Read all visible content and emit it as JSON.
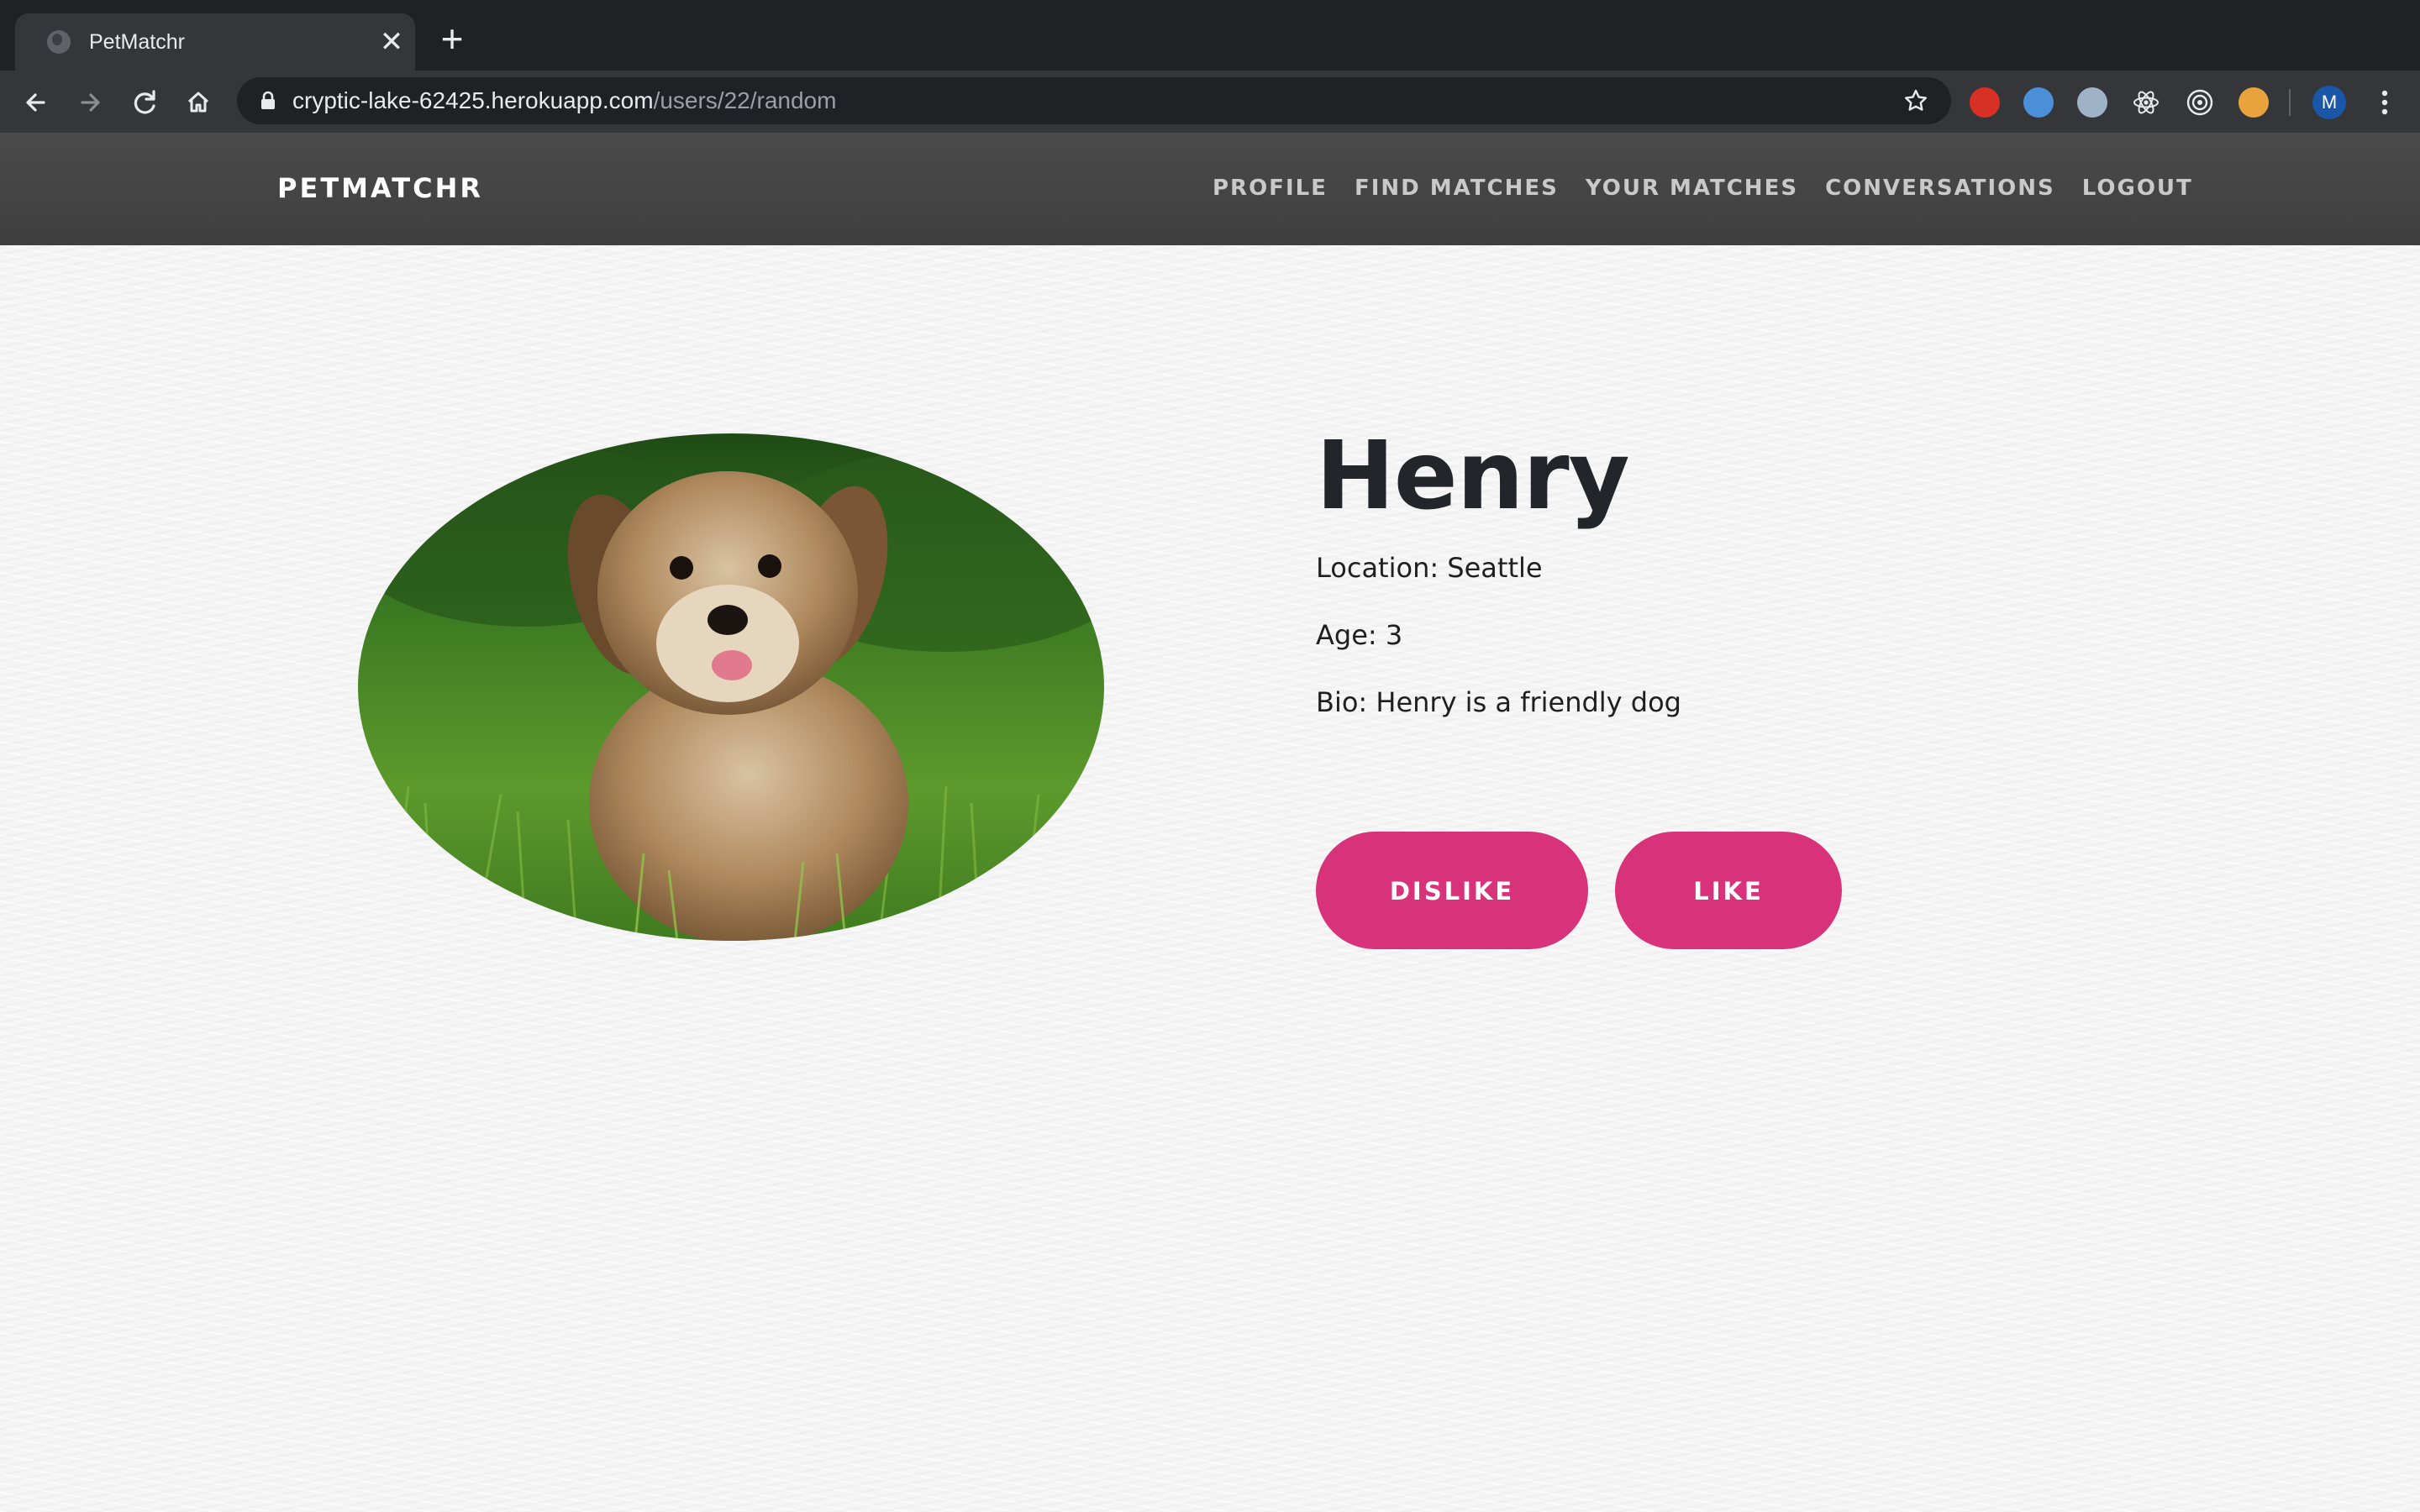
{
  "browser": {
    "tab_title": "PetMatchr",
    "tab_close_glyph": "✕",
    "new_tab_glyph": "+",
    "url_host": "cryptic-lake-62425.herokuapp.com",
    "url_path": "/users/22/random",
    "profile_initial": "M",
    "icons": [
      "back-icon",
      "forward-icon",
      "reload-icon",
      "home-icon",
      "lock-icon",
      "bookmark-star-icon",
      "menu-kebab-icon"
    ],
    "extension_colors": [
      "#d93025",
      "#4a8fd8",
      "#9fb3c8",
      "#e8eaed",
      "#e8eaed",
      "#e8a33d"
    ]
  },
  "site": {
    "brand": "PETMATCHR",
    "nav": [
      {
        "label": "PROFILE"
      },
      {
        "label": "FIND MATCHES"
      },
      {
        "label": "YOUR MATCHES"
      },
      {
        "label": "CONVERSATIONS"
      },
      {
        "label": "LOGOUT"
      }
    ]
  },
  "pet": {
    "name": "Henry",
    "location": "Location: Seattle",
    "age": "Age: 3",
    "bio": "Bio: Henry is a friendly dog"
  },
  "actions": {
    "dislike_label": "DISLIKE",
    "like_label": "LIKE"
  },
  "colors": {
    "accent": "#d8327a",
    "nav_bg": "#444444",
    "chrome_bg": "#202124"
  }
}
